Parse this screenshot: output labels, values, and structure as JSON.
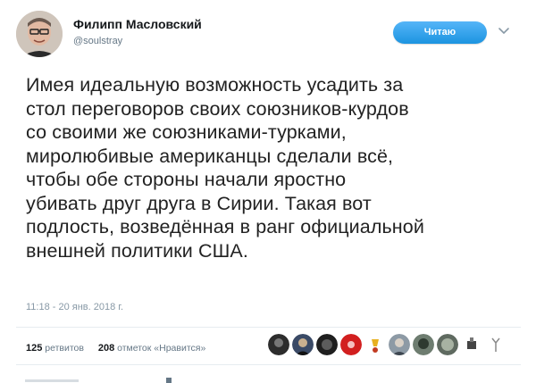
{
  "author": {
    "display_name": "Филипп Масловский",
    "handle": "@soulstray"
  },
  "follow_button_label": "Читаю",
  "tweet": {
    "lines": [
      "Имея идеальную возможность усадить за",
      "стол переговоров своих союзников-курдов",
      "со своими же союзниками-турками,",
      "миролюбивые американцы сделали всё,",
      "чтобы обе стороны начали яростно",
      "убивать друг друга в Сирии. Такая вот",
      "подлость, возведённая в ранг официальной",
      "внешней политики США."
    ],
    "timestamp": "11:18 - 20 янв. 2018 г."
  },
  "stats": {
    "retweets_count": "125",
    "retweets_label": "ретвитов",
    "likes_count": "208",
    "likes_label": "отметок «Нравится»"
  },
  "colors": {
    "follow_button": "#1da1f2",
    "secondary_text": "#657786",
    "divider": "#e6ecf0"
  },
  "icons": {
    "more": "chevron-down-icon"
  }
}
